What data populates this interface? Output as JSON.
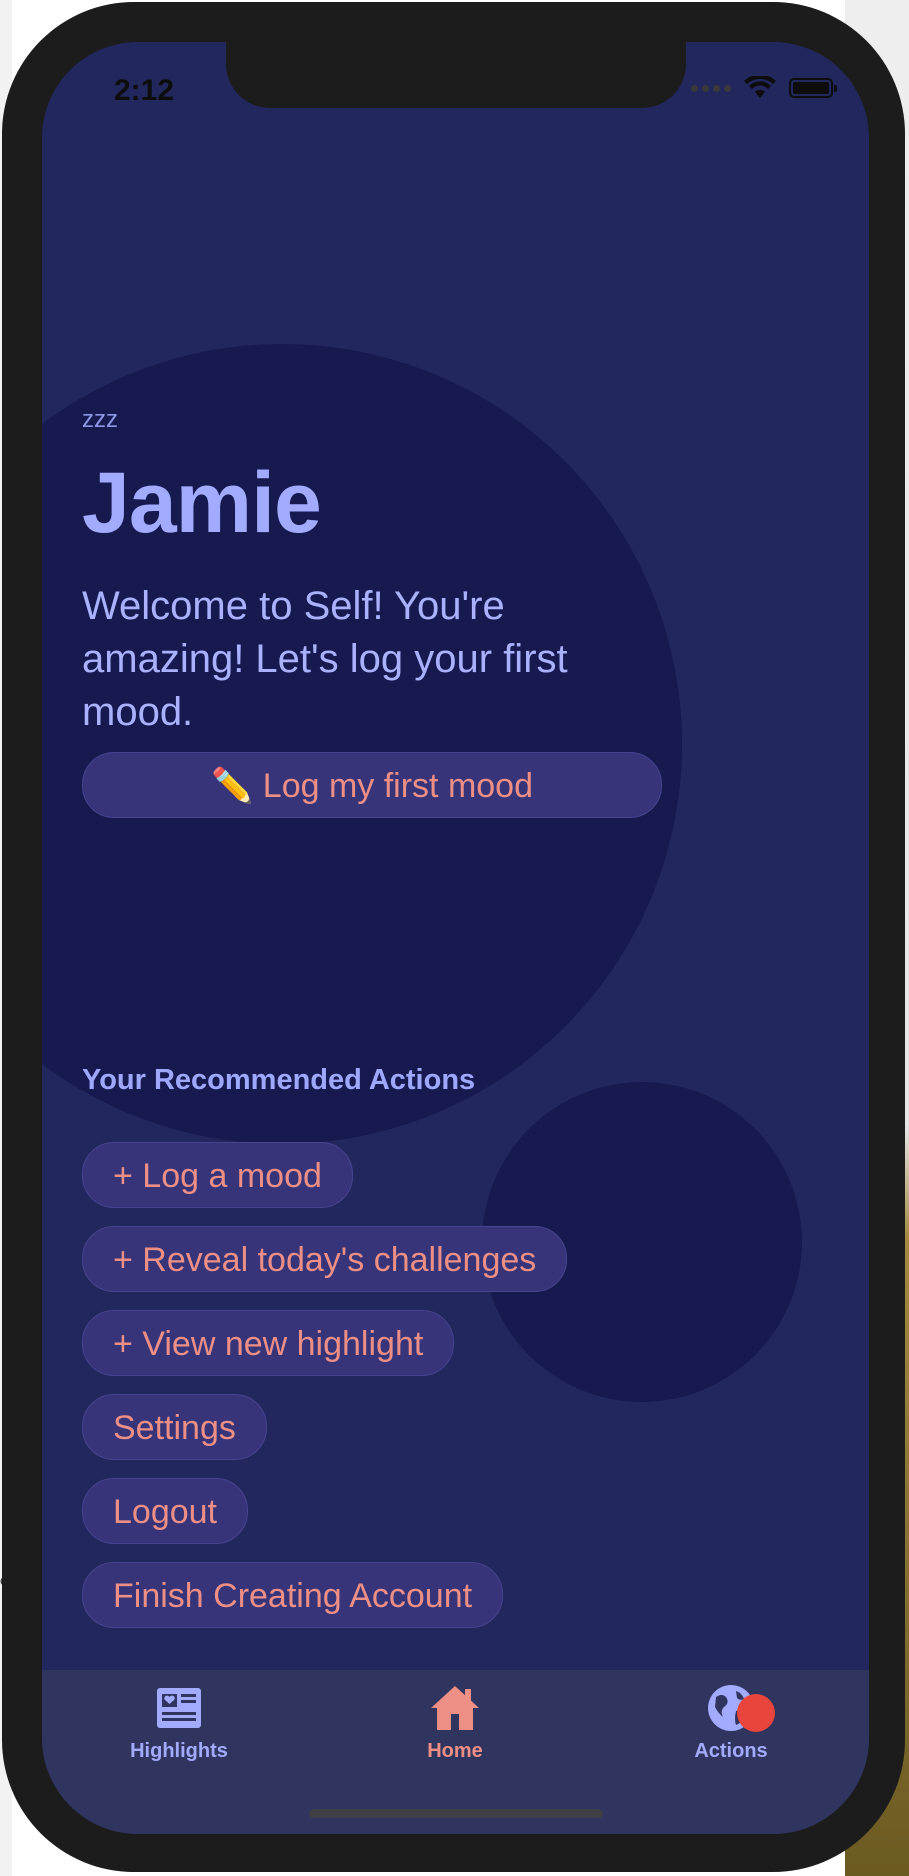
{
  "status_bar": {
    "time": "2:12"
  },
  "profile": {
    "mood_tag": "zzz",
    "name": "Jamie",
    "welcome": "Welcome to Self! You're amazing! Let's log your first mood."
  },
  "primary_action": {
    "icon": "pencil-icon",
    "emoji": "✏️",
    "label": "Log my first mood"
  },
  "recommended": {
    "title": "Your Recommended Actions",
    "actions": [
      {
        "label": "+ Log a mood"
      },
      {
        "label": "+ Reveal today's challenges"
      },
      {
        "label": "+ View new highlight"
      },
      {
        "label": "Settings"
      },
      {
        "label": "Logout"
      },
      {
        "label": "Finish Creating Account"
      }
    ]
  },
  "tabbar": {
    "tabs": [
      {
        "label": "Highlights",
        "icon": "newspaper-icon"
      },
      {
        "label": "Home",
        "icon": "home-icon",
        "active": true
      },
      {
        "label": "Actions",
        "icon": "globe-icon",
        "badge": true
      }
    ]
  },
  "desktop": {
    "edge_label": "oc"
  },
  "colors": {
    "screen_bg": "#22285e",
    "circle_bg": "#161a4f",
    "accent_text": "#ee8f86",
    "name_color": "#a3abff",
    "pill_bg": "#37347a",
    "tabbar_bg": "#30355f",
    "badge": "#e8453c"
  }
}
